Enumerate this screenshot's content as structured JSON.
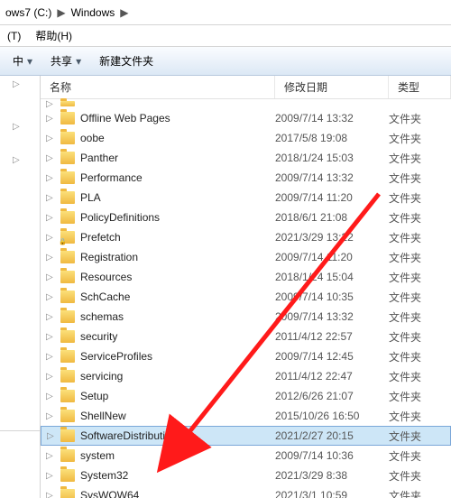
{
  "breadcrumb": {
    "seg1": "ows7 (C:)",
    "seg2": "Windows"
  },
  "menu": {
    "item1": "(T)",
    "item2": "帮助(H)"
  },
  "toolbar": {
    "item1": "中",
    "item2": "共享",
    "item3": "新建文件夹"
  },
  "columns": {
    "name": "名称",
    "modified": "修改日期",
    "type": "类型"
  },
  "type_folder": "文件夹",
  "rows": [
    {
      "name": "",
      "date": "",
      "type": "",
      "trunc": true
    },
    {
      "name": "Offline Web Pages",
      "date": "2009/7/14 13:32",
      "type": "文件夹"
    },
    {
      "name": "oobe",
      "date": "2017/5/8 19:08",
      "type": "文件夹"
    },
    {
      "name": "Panther",
      "date": "2018/1/24 15:03",
      "type": "文件夹"
    },
    {
      "name": "Performance",
      "date": "2009/7/14 13:32",
      "type": "文件夹"
    },
    {
      "name": "PLA",
      "date": "2009/7/14 11:20",
      "type": "文件夹"
    },
    {
      "name": "PolicyDefinitions",
      "date": "2018/6/1 21:08",
      "type": "文件夹"
    },
    {
      "name": "Prefetch",
      "date": "2021/3/29 13:22",
      "type": "文件夹",
      "lock": true
    },
    {
      "name": "Registration",
      "date": "2009/7/14 11:20",
      "type": "文件夹"
    },
    {
      "name": "Resources",
      "date": "2018/1/24 15:04",
      "type": "文件夹"
    },
    {
      "name": "SchCache",
      "date": "2009/7/14 10:35",
      "type": "文件夹"
    },
    {
      "name": "schemas",
      "date": "2009/7/14 13:32",
      "type": "文件夹"
    },
    {
      "name": "security",
      "date": "2011/4/12 22:57",
      "type": "文件夹"
    },
    {
      "name": "ServiceProfiles",
      "date": "2009/7/14 12:45",
      "type": "文件夹"
    },
    {
      "name": "servicing",
      "date": "2011/4/12 22:47",
      "type": "文件夹"
    },
    {
      "name": "Setup",
      "date": "2012/6/26 21:07",
      "type": "文件夹"
    },
    {
      "name": "ShellNew",
      "date": "2015/10/26 16:50",
      "type": "文件夹"
    },
    {
      "name": "SoftwareDistribution",
      "date": "2021/2/27 20:15",
      "type": "文件夹",
      "selected": true
    },
    {
      "name": "system",
      "date": "2009/7/14 10:36",
      "type": "文件夹"
    },
    {
      "name": "System32",
      "date": "2021/3/29 8:38",
      "type": "文件夹"
    },
    {
      "name": "SysWOW64",
      "date": "2021/3/1 10:59",
      "type": "文件夹"
    }
  ]
}
